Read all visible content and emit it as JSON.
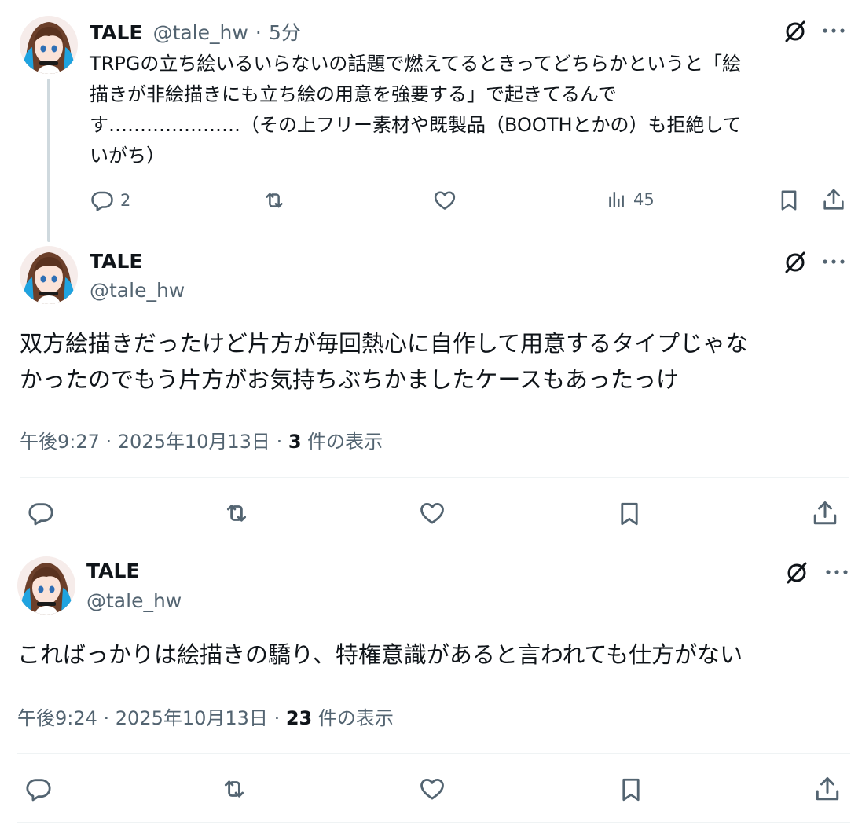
{
  "tweet1": {
    "name": "TALE",
    "handle": "@tale_hw",
    "time_sep": "·",
    "time": "5分",
    "text_lines": [
      "TRPGの立ち絵いるいらないの話題で燃えてるときってどちらかというと「絵",
      "描きが非絵描きにも立ち絵の用意を強要する」で起きてるんで",
      "す…………………（その上フリー素材や既製品（BOOTHとかの）も拒絶して",
      "いがち）"
    ],
    "replies": "2",
    "views": "45"
  },
  "tweet2": {
    "name": "TALE",
    "handle": "@tale_hw",
    "text_lines": [
      "双方絵描きだったけど片方が毎回熱心に自作して用意するタイプじゃな",
      "かったのでもう片方がお気持ちぶちかましたケースもあったっけ"
    ],
    "timestamp": "午後9:27 · 2025年10月13日 · ",
    "views_count": "3",
    "views_label": " 件の表示"
  },
  "tweet3": {
    "name": "TALE",
    "handle": "@tale_hw",
    "text": "こればっかりは絵描きの驕り、特権意識があると言われても仕方がない",
    "timestamp": "午後9:24 · 2025年10月13日 · ",
    "views_count": "23",
    "views_label": " 件の表示"
  },
  "icons": {
    "grok": "grok-slash-icon",
    "more": "more-dots-icon",
    "reply": "reply-icon",
    "retweet": "retweet-icon",
    "like": "like-icon",
    "views": "views-icon",
    "bookmark": "bookmark-icon",
    "share": "share-icon"
  },
  "colors": {
    "text": "#0f1419",
    "secondary": "#536471",
    "divider": "#eff3f4",
    "avatar_hair": "#6b3f2a",
    "avatar_accent": "#1fa3e0"
  }
}
